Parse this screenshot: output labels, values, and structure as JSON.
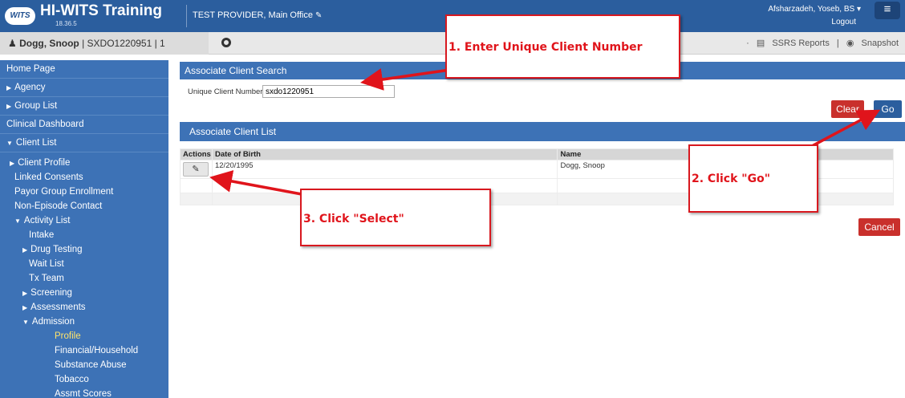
{
  "header": {
    "logo_text": "WITS",
    "app_title": "HI-WITS Training",
    "version": "18.36.5",
    "provider": "TEST PROVIDER, Main Office",
    "user": "Afsharzadeh, Yoseb, BS ▾",
    "logout": "Logout",
    "menu_icon": "≡"
  },
  "subheader": {
    "client_name": "Dogg, Snoop",
    "client_id": " | SXDO1220951 | 1",
    "ssrs_reports": "SSRS Reports",
    "snapshot": "Snapshot",
    "separator": "|"
  },
  "sidebar": {
    "items": [
      {
        "label": "Home Page"
      },
      {
        "label": "Agency"
      },
      {
        "label": "Group List"
      },
      {
        "label": "Clinical Dashboard"
      },
      {
        "label": "Client List"
      },
      {
        "label": "Client Profile"
      },
      {
        "label": "Linked Consents"
      },
      {
        "label": "Payor Group Enrollment"
      },
      {
        "label": "Non-Episode Contact"
      },
      {
        "label": "Activity List"
      },
      {
        "label": "Intake"
      },
      {
        "label": "Drug Testing"
      },
      {
        "label": "Wait List"
      },
      {
        "label": "Tx Team"
      },
      {
        "label": "Screening"
      },
      {
        "label": "Assessments"
      },
      {
        "label": "Admission"
      },
      {
        "label": "Profile"
      },
      {
        "label": "Financial/Household"
      },
      {
        "label": "Substance Abuse"
      },
      {
        "label": "Tobacco"
      },
      {
        "label": "Assmt Scores"
      }
    ]
  },
  "search_panel": {
    "title": "Associate Client Search",
    "field_label": "Unique Client Number",
    "field_value": "sxdo1220951",
    "clear_label": "Clear",
    "go_label": "Go"
  },
  "list_panel": {
    "title": "Associate Client List",
    "columns": [
      "Actions",
      "Date of Birth",
      "Name"
    ],
    "rows": [
      {
        "dob": "12/20/1995",
        "name": "Dogg, Snoop"
      }
    ],
    "cancel_label": "Cancel"
  },
  "callouts": {
    "step1": "1. Enter Unique Client Number",
    "step2": "2. Click \"Go\"",
    "step3": "3. Click \"Select\""
  },
  "colors": {
    "header_blue": "#2b5e9e",
    "sidebar_blue": "#3d72b6",
    "danger_red": "#c9302c",
    "callout_red": "#e0141b",
    "active_nav": "#ffe46b"
  }
}
